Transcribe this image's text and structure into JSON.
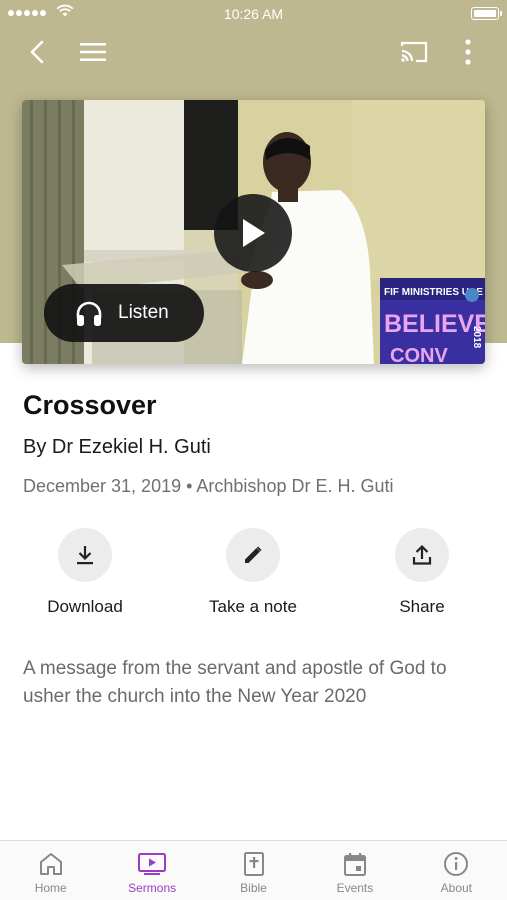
{
  "status_bar": {
    "time": "10:26 AM"
  },
  "toolbar": {
    "back_icon": "chevron-left-icon",
    "menu_icon": "hamburger-icon",
    "cast_icon": "cast-icon",
    "more_icon": "more-vertical-icon"
  },
  "media": {
    "banner_line1": "FIF MINISTRIES UAE",
    "banner_line2": "BELIEVERS",
    "banner_line3": "CONV",
    "banner_year": "2018",
    "listen_label": "Listen"
  },
  "sermon": {
    "title": "Crossover",
    "byline": "By Dr Ezekiel H. Guti",
    "meta": "December 31, 2019 • Archbishop Dr E. H. Guti",
    "description": "A message from the servant and apostle of God to usher the church into the New Year 2020"
  },
  "actions": [
    {
      "label": "Download",
      "icon": "download-icon"
    },
    {
      "label": "Take a note",
      "icon": "pencil-icon"
    },
    {
      "label": "Share",
      "icon": "share-icon"
    }
  ],
  "tabs": [
    {
      "label": "Home",
      "icon": "home-icon"
    },
    {
      "label": "Sermons",
      "icon": "video-icon",
      "active": true
    },
    {
      "label": "Bible",
      "icon": "bible-icon"
    },
    {
      "label": "Events",
      "icon": "calendar-icon"
    },
    {
      "label": "About",
      "icon": "info-icon"
    }
  ],
  "colors": {
    "header_bg": "#bdb88f",
    "accent": "#9b3bc4",
    "inactive": "#888888"
  }
}
